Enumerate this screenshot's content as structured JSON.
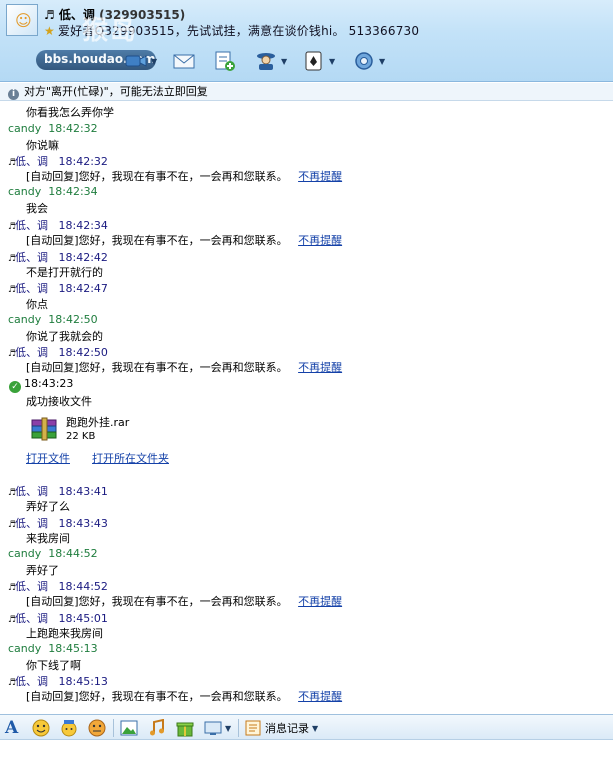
{
  "header": {
    "nickname": "♬ 低、调",
    "qq": "(329903515)",
    "status_message": "爱好者Q329903515，先试试挂，满意在谈价钱hi。 513366730",
    "watermark_text": "bbs.houdao.com",
    "watermark_logo": "猴岛"
  },
  "notice": {
    "text": "对方\"离开(忙碌)\"，可能无法立即回复"
  },
  "messages": [
    {
      "text": "你看我怎么弄你学"
    },
    {
      "name": "candy",
      "time": "18:42:32"
    },
    {
      "text": "你说嘛"
    },
    {
      "name": "低、调",
      "time": "18:42:32"
    },
    {
      "text": "[自动回复]您好，我现在有事不在，一会再和您联系。",
      "link": "不再提醒"
    },
    {
      "name": "candy",
      "time": "18:42:34"
    },
    {
      "text": "我会"
    },
    {
      "name": "低、调",
      "time": "18:42:34"
    },
    {
      "text": "[自动回复]您好，我现在有事不在，一会再和您联系。",
      "link": "不再提醒"
    },
    {
      "name": "低、调",
      "time": "18:42:42"
    },
    {
      "text": "不是打开就行的"
    },
    {
      "name": "低、调",
      "time": "18:42:47"
    },
    {
      "text": "你点"
    },
    {
      "name": "candy",
      "time": "18:42:50"
    },
    {
      "text": "你说了我就会的"
    },
    {
      "name": "低、调",
      "time": "18:42:50"
    },
    {
      "text": "[自动回复]您好，我现在有事不在，一会再和您联系。",
      "link": "不再提醒"
    },
    {
      "time": "18:43:23"
    },
    {
      "text": "成功接收文件"
    },
    {
      "file_name": "跑跑外挂.rar",
      "file_size": "22 KB"
    },
    {
      "open_file": "打开文件",
      "open_folder": "打开所在文件夹"
    },
    {
      "name": "低、调",
      "time": "18:43:41"
    },
    {
      "text": "弄好了么"
    },
    {
      "name": "低、调",
      "time": "18:43:43"
    },
    {
      "text": "来我房间"
    },
    {
      "name": "candy",
      "time": "18:44:52"
    },
    {
      "text": "弄好了"
    },
    {
      "name": "低、调",
      "time": "18:44:52"
    },
    {
      "text": "[自动回复]您好，我现在有事不在，一会再和您联系。",
      "link": "不再提醒"
    },
    {
      "name": "低、调",
      "time": "18:45:01"
    },
    {
      "text": "上跑跑来我房间"
    },
    {
      "name": "candy",
      "time": "18:45:13"
    },
    {
      "text": "你下线了啊"
    },
    {
      "name": "低、调",
      "time": "18:45:13"
    },
    {
      "text": "[自动回复]您好，我现在有事不在，一会再和您联系。",
      "link": "不再提醒"
    }
  ],
  "bottombar": {
    "history_label": "消息记录"
  },
  "colors": {
    "accent": "#1441a8",
    "header_bg": "#c3e2f8",
    "my_name": "#1f7d3e",
    "other_name": "#1a1a80"
  }
}
